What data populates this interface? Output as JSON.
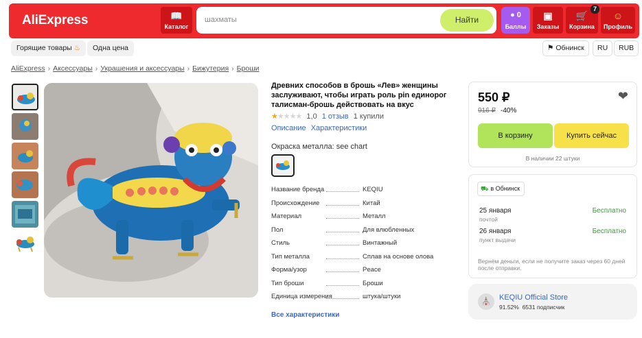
{
  "header": {
    "logo": "AliExpress",
    "catalog_label": "Каталог",
    "search_placeholder": "шахматы",
    "search_button": "Найти",
    "points_count": "0",
    "points_label": "Баллы",
    "orders_label": "Заказы",
    "cart_label": "Корзина",
    "cart_count": "7",
    "profile_label": "Профиль"
  },
  "subnav": {
    "hot_deals": "Горящие товары",
    "one_price": "Одна цена",
    "location": "Обнинск",
    "language": "RU",
    "currency": "RUB"
  },
  "breadcrumbs": [
    "AliExpress",
    "Аксессуары",
    "Украшения и аксессуары",
    "Бижутерия",
    "Броши"
  ],
  "product": {
    "title": "Древних способов в брошь «Лев» женщины заслуживают, чтобы играть роль pin единорог талисман-брошь действовать на вкус",
    "rating_value": "1,0",
    "reviews": "1 отзыв",
    "purchases": "1 купили",
    "tab_description": "Описание",
    "tab_specs": "Характеристики",
    "color_label": "Окраска металла: see chart",
    "specs": [
      {
        "k": "Название бренда",
        "v": "KEQIU"
      },
      {
        "k": "Происхождение",
        "v": "Китай"
      },
      {
        "k": "Материал",
        "v": "Металл"
      },
      {
        "k": "Пол",
        "v": "Для влюбленных"
      },
      {
        "k": "Стиль",
        "v": "Винтажный"
      },
      {
        "k": "Тип металла",
        "v": "Сплав на основе олова"
      },
      {
        "k": "Форма/узор",
        "v": "Peace"
      },
      {
        "k": "Тип броши",
        "v": "Броши"
      },
      {
        "k": "Единица измерения",
        "v": "штука/штуки"
      }
    ],
    "all_specs": "Все характеристики"
  },
  "buy": {
    "price": "550 ₽",
    "old_price": "916 ₽",
    "discount": "-40%",
    "add_to_cart": "В корзину",
    "buy_now": "Купить сейчас",
    "stock": "В наличии 22 штуки"
  },
  "delivery": {
    "city": "в Обнинск",
    "options": [
      {
        "date": "25 января",
        "type": "почтой",
        "price": "Бесплатно"
      },
      {
        "date": "26 января",
        "type": "пункт выдачи",
        "price": "Бесплатно"
      }
    ],
    "refund_note": "Вернём деньги, если не получите заказ через 60 дней после отправки."
  },
  "store": {
    "name": "KEQIU Official Store",
    "rating": "91.52%",
    "subscribers": "6531 подписчик"
  },
  "colors": {
    "brand_red": "#ee2a2f",
    "search_green": "#cfef6b",
    "cart_green": "#b1e35b",
    "buy_yellow": "#f6e148",
    "link_blue": "#3a67c4"
  }
}
